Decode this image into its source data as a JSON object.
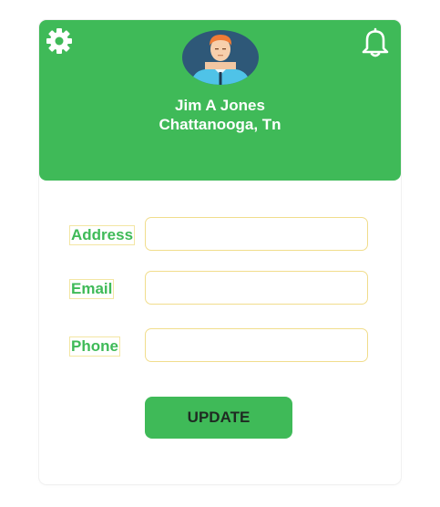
{
  "profile": {
    "name": "Jim A Jones",
    "location": "Chattanooga, Tn"
  },
  "header": {
    "settings_icon": "gear-icon",
    "notifications_icon": "bell-icon",
    "color": "#3fba58"
  },
  "form": {
    "address_label": "Address",
    "address_value": "",
    "email_label": "Email",
    "email_value": "",
    "phone_label": "Phone",
    "phone_value": ""
  },
  "actions": {
    "update_label": "UPDATE"
  }
}
